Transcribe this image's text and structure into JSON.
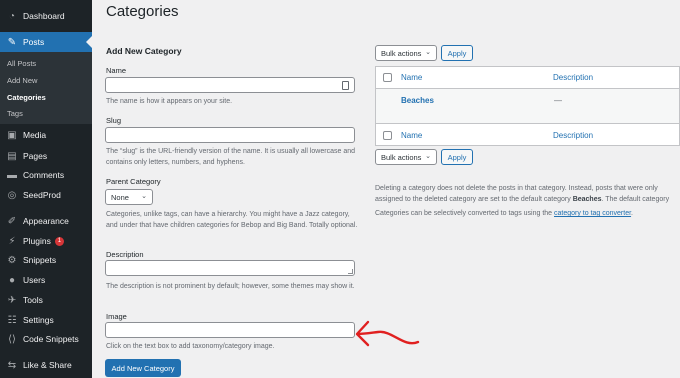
{
  "sidebar": {
    "dashboard": "Dashboard",
    "posts": "Posts",
    "posts_sub": [
      "All Posts",
      "Add New",
      "Categories",
      "Tags"
    ],
    "media": "Media",
    "pages": "Pages",
    "comments": "Comments",
    "seedprod": "SeedProd",
    "appearance": "Appearance",
    "plugins": "Plugins",
    "plugins_badge": "1",
    "snippets": "Snippets",
    "users": "Users",
    "tools": "Tools",
    "settings": "Settings",
    "code_snippets": "Code Snippets",
    "like_share": "Like & Share"
  },
  "page": {
    "title": "Categories"
  },
  "form": {
    "heading": "Add New Category",
    "name_label": "Name",
    "name_help": "The name is how it appears on your site.",
    "slug_label": "Slug",
    "slug_help": "The “slug” is the URL-friendly version of the name. It is usually all lowercase and contains only letters, numbers, and hyphens.",
    "parent_label": "Parent Category",
    "parent_value": "None",
    "parent_help": "Categories, unlike tags, can have a hierarchy. You might have a Jazz category, and under that have children categories for Bebop and Big Band. Totally optional.",
    "description_label": "Description",
    "description_help": "The description is not prominent by default; however, some themes may show it.",
    "image_label": "Image",
    "image_help": "Click on the text box to add taxonomy/category image.",
    "submit_label": "Add New Category"
  },
  "table": {
    "bulk_actions": "Bulk actions",
    "apply": "Apply",
    "col_name": "Name",
    "col_description": "Description",
    "rows": [
      {
        "name": "Beaches",
        "description": "—"
      }
    ]
  },
  "notes": {
    "delete_pre": "Deleting a category does not delete the posts in that category. Instead, posts that were only assigned to the deleted category are set to the default category ",
    "default_category": "Beaches",
    "delete_post": ". The default category cannot be deleted.",
    "convert_pre": "Categories can be selectively converted to tags using the ",
    "convert_link": "category to tag converter",
    "convert_post": "."
  },
  "colors": {
    "accent": "#2271b1",
    "sidebar": "#1d2327",
    "arrow": "#e02020"
  }
}
